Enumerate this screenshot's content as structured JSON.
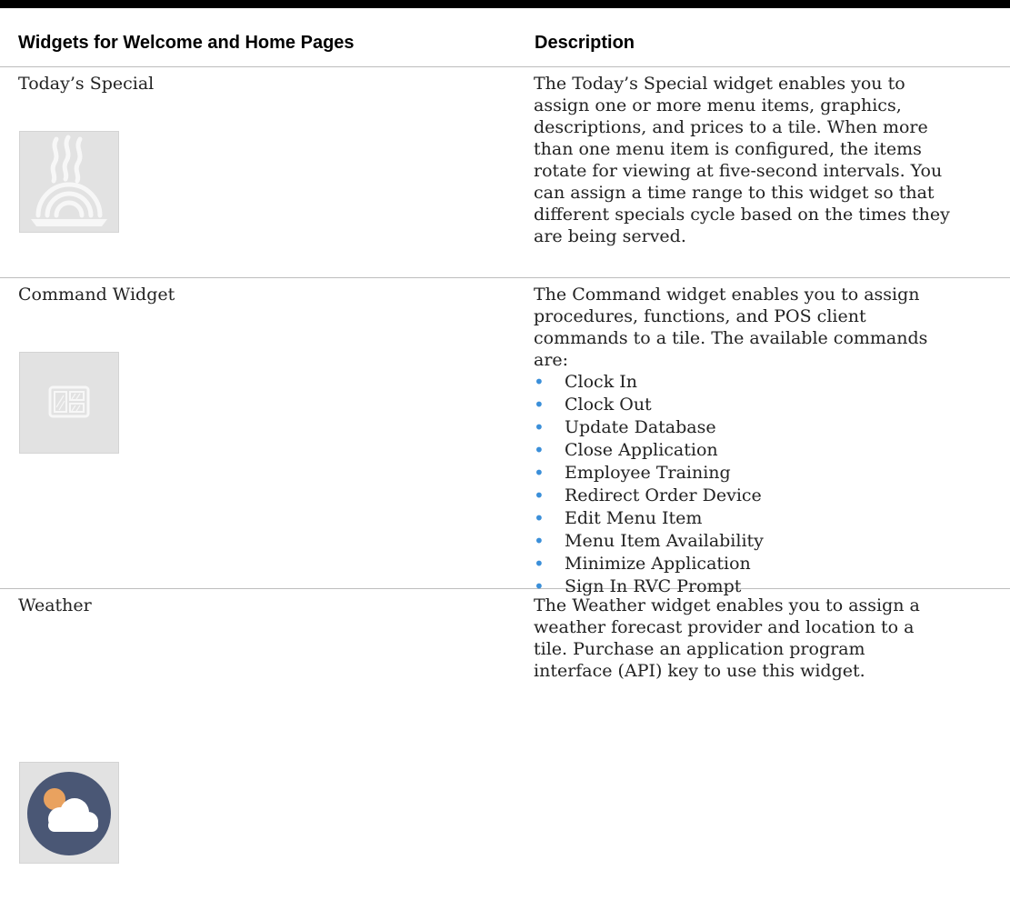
{
  "table": {
    "headers": {
      "widget": "Widgets for Welcome and Home Pages",
      "description": "Description"
    },
    "rows": [
      {
        "name": "Today’s Special",
        "icon": "noodle-bowl-icon",
        "lines": [
          "The Today’s Special widget enables you to",
          "assign one or more menu items, graphics,",
          "descriptions, and prices to a tile. When more",
          "than one menu item is configured, the items",
          "rotate for viewing at five-second intervals. You",
          "can assign a time range to this widget so that",
          "different specials cycle based on the times they",
          "are being served."
        ]
      },
      {
        "name": "Command Widget",
        "icon": "command-tile-icon",
        "lines": [
          "The Command widget enables you to assign",
          "procedures, functions, and POS client",
          "commands to a tile. The available commands",
          "are:"
        ],
        "bullets": [
          "Clock In",
          "Clock Out",
          "Update Database",
          "Close Application",
          "Employee Training",
          "Redirect Order Device",
          "Edit Menu Item",
          "Menu Item Availability",
          "Minimize Application",
          "Sign In RVC Prompt"
        ]
      },
      {
        "name": "Weather",
        "icon": "weather-cloud-sun-icon",
        "lines": [
          "The Weather widget enables you to assign a",
          "weather forecast provider and location to a",
          "tile. Purchase an application program",
          "interface (API) key to use this widget."
        ]
      }
    ]
  },
  "colors": {
    "bullet": "#3b8fd9",
    "thumb_bg": "#e2e2e2",
    "weather_circle": "#4a5775",
    "sun": "#e9a25f"
  }
}
